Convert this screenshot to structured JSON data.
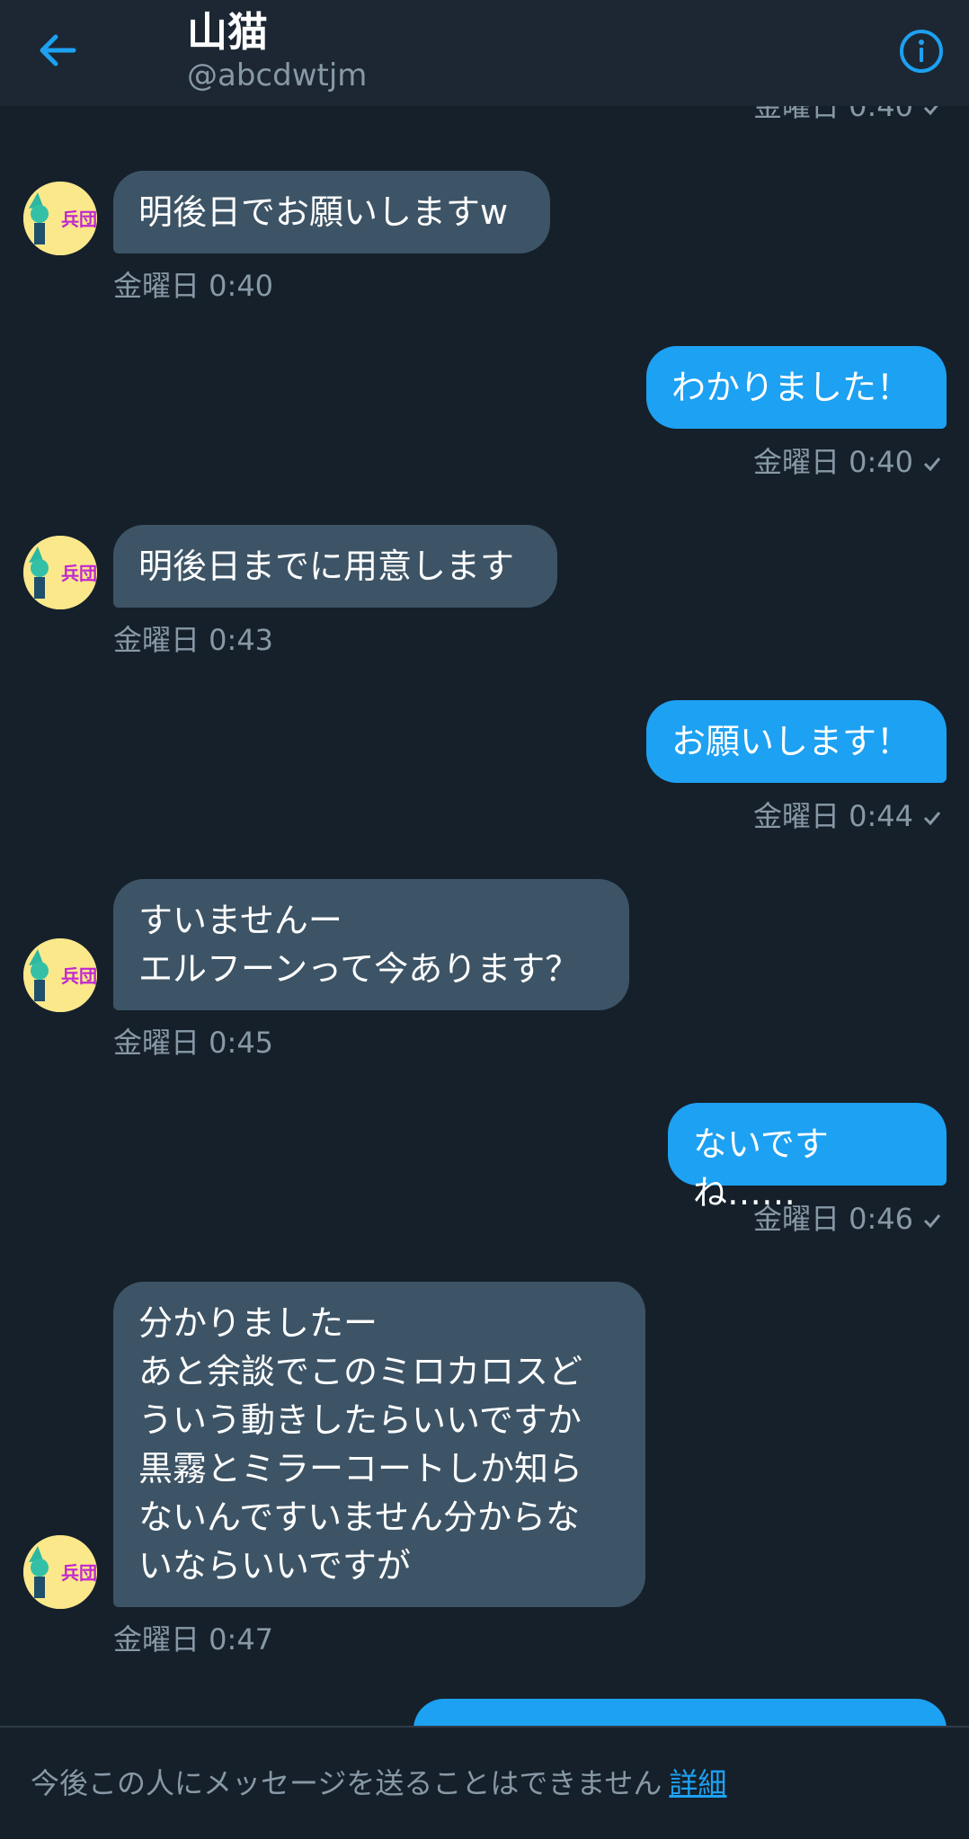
{
  "header": {
    "title": "山猫",
    "handle": "@abcdwtjm"
  },
  "messages": [
    {
      "direction": "in",
      "text": "明後日でお願いしますw",
      "time": "金曜日 0:40"
    },
    {
      "direction": "out",
      "text": "わかりました！",
      "time": "金曜日 0:40"
    },
    {
      "direction": "in",
      "text": "明後日までに用意します",
      "time": "金曜日 0:43"
    },
    {
      "direction": "out",
      "text": "お願いします！",
      "time": "金曜日 0:44"
    },
    {
      "direction": "in",
      "text": "すいませんー\nエルフーンって今あります？",
      "time": "金曜日 0:45"
    },
    {
      "direction": "out",
      "text": "ないですね……",
      "time": "金曜日 0:46"
    },
    {
      "direction": "in",
      "text": "分かりましたー\nあと余談でこのミロカロスど\nういう動きしたらいいですか\n黒霧とミラーコートしか知ら\nないんですいません分からな\nいならいいですが",
      "time": "金曜日 0:47"
    }
  ],
  "top_partial_time": "金曜日 0:40",
  "avatar": {
    "label": "兵団",
    "bg": "#fbe88a",
    "label_color": "#c026d3"
  },
  "footer": {
    "notice": "今後この人にメッセージを送ることはできません",
    "link": "詳細"
  },
  "colors": {
    "background": "#15202b",
    "header": "#1d2733",
    "incoming_bubble": "#3d5466",
    "outgoing_bubble": "#1da1f2",
    "secondary_text": "#8899a6",
    "accent": "#1da1f2"
  },
  "icons": {
    "back": "arrow-left-icon",
    "info": "info-circle-icon",
    "read": "checkmark-icon"
  }
}
